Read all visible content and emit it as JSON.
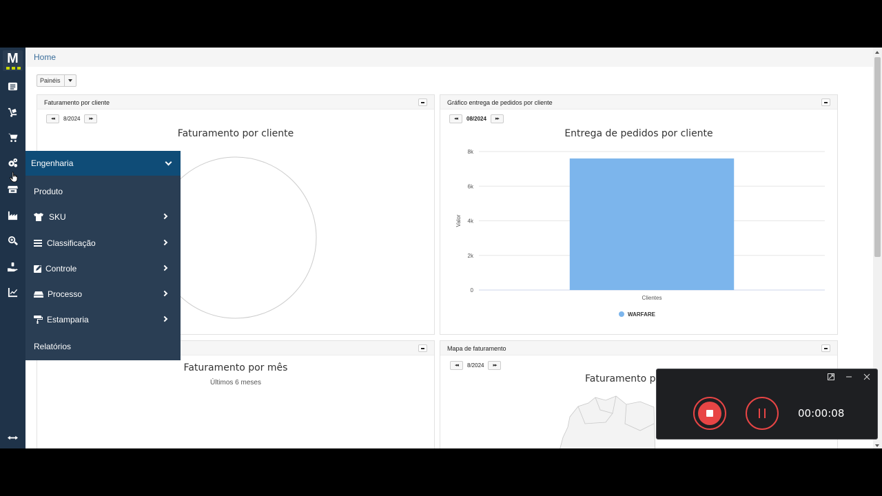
{
  "breadcrumb": "Home",
  "panels_button": "Painéis",
  "panels": [
    {
      "header": "Faturamento por cliente",
      "period": "8/2024",
      "title": "Faturamento por cliente"
    },
    {
      "header": "Gráfico entrega de pedidos por cliente",
      "period": "08/2024",
      "title": "Entrega de pedidos por cliente"
    },
    {
      "header": "",
      "title": "Faturamento por mês",
      "subtitle": "Últimos 6 meses"
    },
    {
      "header": "Mapa de faturamento",
      "period": "8/2024",
      "title": "Faturamento po"
    }
  ],
  "pager": {
    "prev": "◂◂",
    "next": "▸▸"
  },
  "menu": {
    "header": "Engenharia",
    "items": [
      {
        "label": "Produto",
        "icon": "none"
      },
      {
        "label": "SKU",
        "icon": "tshirt-icon",
        "submenu": true
      },
      {
        "label": "Classificação",
        "icon": "list-icon",
        "submenu": true
      },
      {
        "label": "Controle",
        "icon": "edit-icon",
        "submenu": true
      },
      {
        "label": "Processo",
        "icon": "layers-icon",
        "submenu": true
      },
      {
        "label": "Estamparia",
        "icon": "paint-roller-icon",
        "submenu": true
      },
      {
        "label": "Relatórios",
        "icon": "none"
      }
    ]
  },
  "sidebar_icons": [
    "list-icon",
    "dolly-icon",
    "cart-icon",
    "cogs-icon",
    "store-icon",
    "industry-icon",
    "search-plus-icon",
    "hand-holding-icon",
    "chart-line-icon",
    "expand-horizontal-icon"
  ],
  "chart_data": [
    {
      "type": "pie",
      "title": "Faturamento por cliente",
      "values": []
    },
    {
      "type": "bar",
      "title": "Entrega de pedidos por cliente",
      "categories": [
        "Clientes"
      ],
      "series": [
        {
          "name": "WARFARE",
          "values": [
            7600
          ]
        }
      ],
      "xlabel": "Clientes",
      "ylabel": "Valor",
      "ylim": [
        0,
        8000
      ],
      "yticks": [
        "0",
        "2k",
        "4k",
        "6k",
        "8k"
      ],
      "color": "#7cb5ec",
      "legend": "bottom"
    }
  ],
  "recorder": {
    "time": "00:00:08"
  },
  "colors": {
    "sidebar": "#1f3349",
    "menu_header": "#0f4c77",
    "menu": "#2a3e54",
    "record": "#e84545"
  }
}
